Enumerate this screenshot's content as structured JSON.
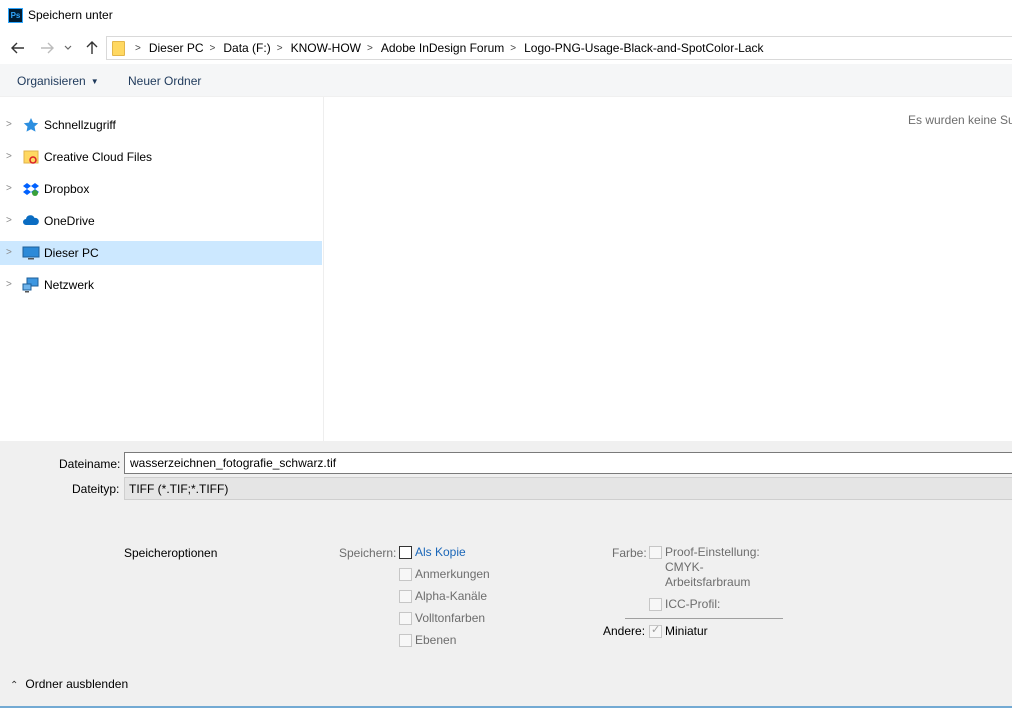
{
  "window": {
    "title": "Speichern unter",
    "app_icon": "Ps"
  },
  "nav": {
    "back_icon": "arrow-left-icon",
    "forward_icon": "arrow-right-icon",
    "recent_icon": "chevron-down-icon",
    "up_icon": "arrow-up-icon",
    "breadcrumbs": [
      "Dieser PC",
      "Data (F:)",
      "KNOW-HOW",
      "Adobe InDesign Forum",
      "Logo-PNG-Usage-Black-and-SpotColor-Lack"
    ]
  },
  "toolbar": {
    "organize_label": "Organisieren",
    "new_folder_label": "Neuer Ordner"
  },
  "sidebar": {
    "items": [
      {
        "label": "Schnellzugriff",
        "icon": "star-icon",
        "selected": false
      },
      {
        "label": "Creative Cloud Files",
        "icon": "creative-cloud-folder-icon",
        "selected": false
      },
      {
        "label": "Dropbox",
        "icon": "dropbox-icon",
        "selected": false
      },
      {
        "label": "OneDrive",
        "icon": "onedrive-cloud-icon",
        "selected": false
      },
      {
        "label": "Dieser PC",
        "icon": "computer-icon",
        "selected": true
      },
      {
        "label": "Netzwerk",
        "icon": "network-icon",
        "selected": false
      }
    ]
  },
  "content": {
    "empty_message": "Es wurden keine Suc"
  },
  "form": {
    "filename_label": "Dateiname:",
    "filename_value": "wasserzeichnen_fotografie_schwarz.tif",
    "filetype_label": "Dateityp:",
    "filetype_value": "TIFF (*.TIF;*.TIFF)"
  },
  "options": {
    "title": "Speicheroptionen",
    "save_label": "Speichern:",
    "save_items": [
      {
        "label": "Als Kopie",
        "checked": false,
        "enabled": true
      },
      {
        "label": "Anmerkungen",
        "checked": false,
        "enabled": false
      },
      {
        "label": "Alpha-Kanäle",
        "checked": false,
        "enabled": false
      },
      {
        "label": "Volltonfarben",
        "checked": false,
        "enabled": false
      },
      {
        "label": "Ebenen",
        "checked": false,
        "enabled": false
      }
    ],
    "color_label": "Farbe:",
    "proof_label_line1": "Proof-Einstellung:",
    "proof_label_line2": "CMYK-",
    "proof_label_line3": "Arbeitsfarbraum",
    "icc_label": "ICC-Profil:",
    "other_label": "Andere:",
    "thumbnail_label": "Miniatur",
    "thumbnail_checked": true
  },
  "footer": {
    "hide_folders_label": "Ordner ausblenden"
  },
  "colors": {
    "selection": "#cce8ff",
    "link": "#1a66b8",
    "toolbar_text": "#1e395b"
  }
}
